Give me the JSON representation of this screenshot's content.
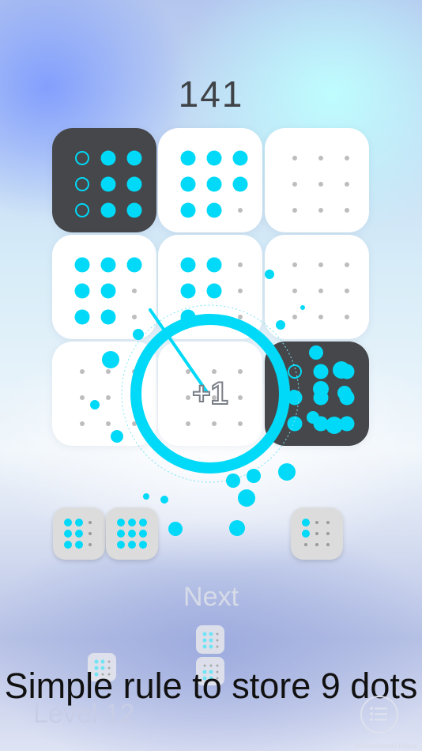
{
  "score": "141",
  "board": [
    {
      "dark": true,
      "cells": [
        "ring",
        "full",
        "full",
        "ring",
        "full",
        "full",
        "ring",
        "full",
        "full"
      ]
    },
    {
      "dark": false,
      "cells": [
        "full",
        "full",
        "full",
        "full",
        "full",
        "full",
        "full",
        "full",
        "empty"
      ]
    },
    {
      "dark": false,
      "cells": [
        "empty",
        "empty",
        "empty",
        "empty",
        "empty",
        "empty",
        "empty",
        "empty",
        "empty"
      ]
    },
    {
      "dark": false,
      "cells": [
        "full",
        "full",
        "full",
        "full",
        "full",
        "empty",
        "full",
        "full",
        "empty"
      ]
    },
    {
      "dark": false,
      "cells": [
        "full",
        "full",
        "empty",
        "full",
        "full",
        "empty",
        "full",
        "empty",
        "empty"
      ]
    },
    {
      "dark": false,
      "cells": [
        "empty",
        "empty",
        "empty",
        "empty",
        "empty",
        "empty",
        "empty",
        "empty",
        "empty"
      ]
    },
    {
      "dark": false,
      "cells": [
        "empty",
        "empty",
        "empty",
        "empty",
        "empty",
        "empty",
        "empty",
        "empty",
        "empty"
      ]
    },
    {
      "dark": false,
      "cells": [
        "empty",
        "empty",
        "empty",
        "empty",
        "empty",
        "empty",
        "empty",
        "empty",
        "empty"
      ]
    },
    {
      "dark": true,
      "cells": [
        "ring",
        "full",
        "full",
        "full",
        "full",
        "full",
        "full",
        "full",
        "full"
      ]
    }
  ],
  "tray": [
    {
      "cells": [
        "full",
        "full",
        "empty",
        "full",
        "full",
        "empty",
        "full",
        "full",
        "empty"
      ]
    },
    {
      "cells": [
        "full",
        "full",
        "full",
        "full",
        "full",
        "full",
        "full",
        "full",
        "full"
      ]
    },
    {
      "cells": [
        "full",
        "empty",
        "empty",
        "full",
        "empty",
        "empty",
        "empty",
        "empty",
        "empty"
      ]
    }
  ],
  "upcoming": [
    {
      "cells": [
        "full",
        "full",
        "empty",
        "full",
        "full",
        "empty",
        "full",
        "empty",
        "empty"
      ]
    },
    {
      "cells": [
        "full",
        "full",
        "empty",
        "full",
        "full",
        "empty",
        "full",
        "full",
        "empty"
      ]
    },
    {
      "cells": [
        "empty",
        "empty",
        "empty",
        "full",
        "full",
        "empty",
        "full",
        "full",
        "empty"
      ]
    }
  ],
  "plus_label": "+1",
  "next_label": "Next",
  "level_label": "Level 12",
  "caption": "Simple rule to store 9 dots",
  "menu_icon": "list-menu-icon",
  "watermark": "Uncompressed Rogue",
  "colors": {
    "accent": "#00d9f7",
    "dark_tile": "#45474a",
    "light_tile": "#ffffff"
  }
}
